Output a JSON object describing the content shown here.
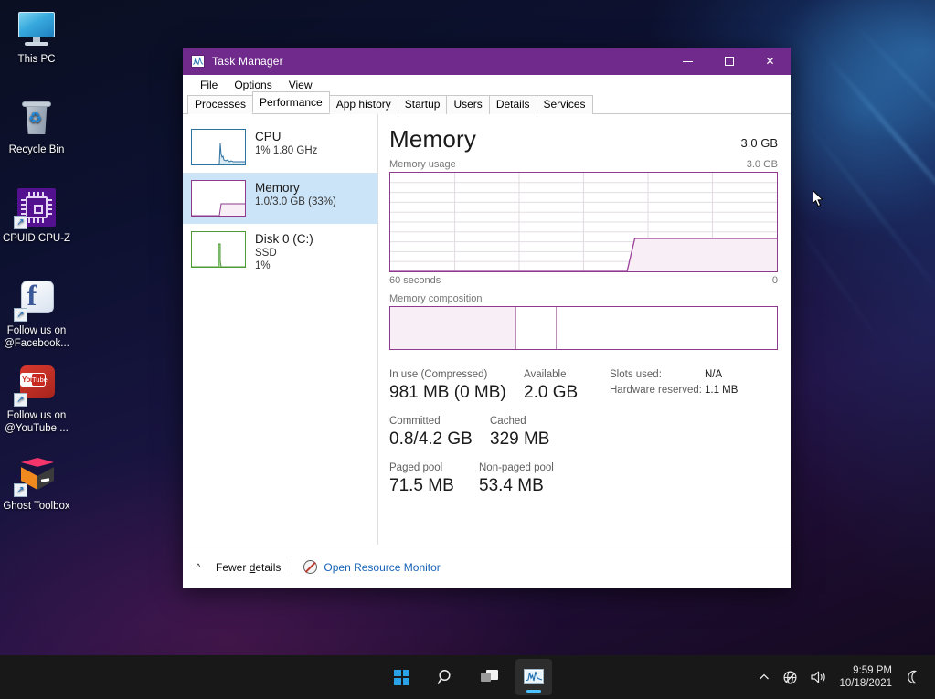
{
  "desktop": {
    "icons": [
      {
        "label": "This PC",
        "icon": "this-pc-icon",
        "shortcut": false
      },
      {
        "label": "Recycle Bin",
        "icon": "recycle-bin-icon",
        "shortcut": false
      },
      {
        "label": "CPUID CPU-Z",
        "icon": "cpu-z-icon",
        "shortcut": true
      },
      {
        "label": "Follow us on @Facebook...",
        "icon": "facebook-icon",
        "shortcut": true
      },
      {
        "label": "Follow us on @YouTube ...",
        "icon": "youtube-icon",
        "shortcut": true
      },
      {
        "label": "Ghost Toolbox",
        "icon": "ghost-toolbox-icon",
        "shortcut": true
      }
    ]
  },
  "window": {
    "title": "Task Manager",
    "app_icon": "task-manager-icon",
    "controls": {
      "minimize": "minimize-icon",
      "maximize": "maximize-icon",
      "close": "close-icon"
    },
    "menu": [
      "File",
      "Options",
      "View"
    ],
    "tabs": [
      {
        "label": "Processes",
        "active": false
      },
      {
        "label": "Performance",
        "active": true
      },
      {
        "label": "App history",
        "active": false
      },
      {
        "label": "Startup",
        "active": false
      },
      {
        "label": "Users",
        "active": false
      },
      {
        "label": "Details",
        "active": false
      },
      {
        "label": "Services",
        "active": false
      }
    ]
  },
  "sidebar": {
    "items": [
      {
        "name": "CPU",
        "sub1": "1%  1.80 GHz",
        "sub2": "",
        "color": "#2e72a0",
        "active": false
      },
      {
        "name": "Memory",
        "sub1": "1.0/3.0 GB (33%)",
        "sub2": "",
        "color": "#8e3a8e",
        "active": true
      },
      {
        "name": "Disk 0 (C:)",
        "sub1": "SSD",
        "sub2": "1%",
        "color": "#4e9a37",
        "active": false
      }
    ]
  },
  "main": {
    "title": "Memory",
    "total_right": "3.0 GB",
    "graph_caption_left": "Memory usage",
    "graph_caption_right": "3.0 GB",
    "axis_left": "60 seconds",
    "axis_right": "0",
    "composition_caption": "Memory composition",
    "stats": [
      {
        "label": "In use (Compressed)",
        "value": "981 MB (0 MB)"
      },
      {
        "label": "Available",
        "value": "2.0 GB"
      },
      {
        "label": "Committed",
        "value": "0.8/4.2 GB"
      },
      {
        "label": "Cached",
        "value": "329 MB"
      },
      {
        "label": "Paged pool",
        "value": "71.5 MB"
      },
      {
        "label": "Non-paged pool",
        "value": "53.4 MB"
      }
    ],
    "hardware": [
      {
        "label": "Slots used:",
        "value": "N/A"
      },
      {
        "label": "Hardware reserved:",
        "value": "1.1 MB"
      }
    ]
  },
  "footer": {
    "collapse_icon": "chevron-up-icon",
    "fewer_details_pre": "Fewer ",
    "fewer_details_underlined": "d",
    "fewer_details_post": "etails",
    "resource_monitor_icon": "resource-monitor-icon",
    "resource_monitor_label": "Open Resource Monitor"
  },
  "taskbar": {
    "buttons": [
      {
        "name": "start",
        "icon": "windows-logo-icon",
        "active": false
      },
      {
        "name": "search",
        "icon": "search-icon",
        "active": false
      },
      {
        "name": "task-view",
        "icon": "task-view-icon",
        "active": false
      },
      {
        "name": "task-manager",
        "icon": "task-manager-icon",
        "active": true
      }
    ],
    "tray": {
      "overflow_icon": "chevron-up-icon",
      "network_icon": "network-no-internet-icon",
      "volume_icon": "volume-icon",
      "time": "9:59 PM",
      "date": "10/18/2021",
      "notification_icon": "focus-assist-moon-icon"
    }
  },
  "colors": {
    "titlebar": "#702a8c",
    "memory_accent": "#8e3a8e",
    "cpu_accent": "#2e72a0",
    "disk_accent": "#4e9a37",
    "selection": "#cce4f7",
    "link": "#1763b8"
  },
  "chart_data": {
    "type": "area",
    "title": "Memory usage",
    "ylabel": "3.0 GB",
    "xlabel": "60 seconds",
    "ylim": [
      0,
      3.0
    ],
    "xlim": [
      60,
      0
    ],
    "grid": true,
    "grid_cols": 6,
    "grid_rows": 10,
    "series": [
      {
        "name": "In use memory",
        "color": "#8e3a8e",
        "points": [
          {
            "t": 60,
            "v": 0.0
          },
          {
            "t": 30,
            "v": 0.0
          },
          {
            "t": 24,
            "v": 0.0
          },
          {
            "t": 22.5,
            "v": 1.0
          },
          {
            "t": 12,
            "v": 1.0
          },
          {
            "t": 0,
            "v": 1.0
          }
        ]
      }
    ]
  },
  "composition_data": {
    "type": "bar",
    "title": "Memory composition",
    "segments": [
      {
        "name": "In use",
        "fraction": 0.323,
        "filled": true
      },
      {
        "name": "Modified",
        "fraction": 0.105,
        "filled": false
      },
      {
        "name": "Standby / Free",
        "fraction": 0.572,
        "filled": false
      }
    ]
  }
}
